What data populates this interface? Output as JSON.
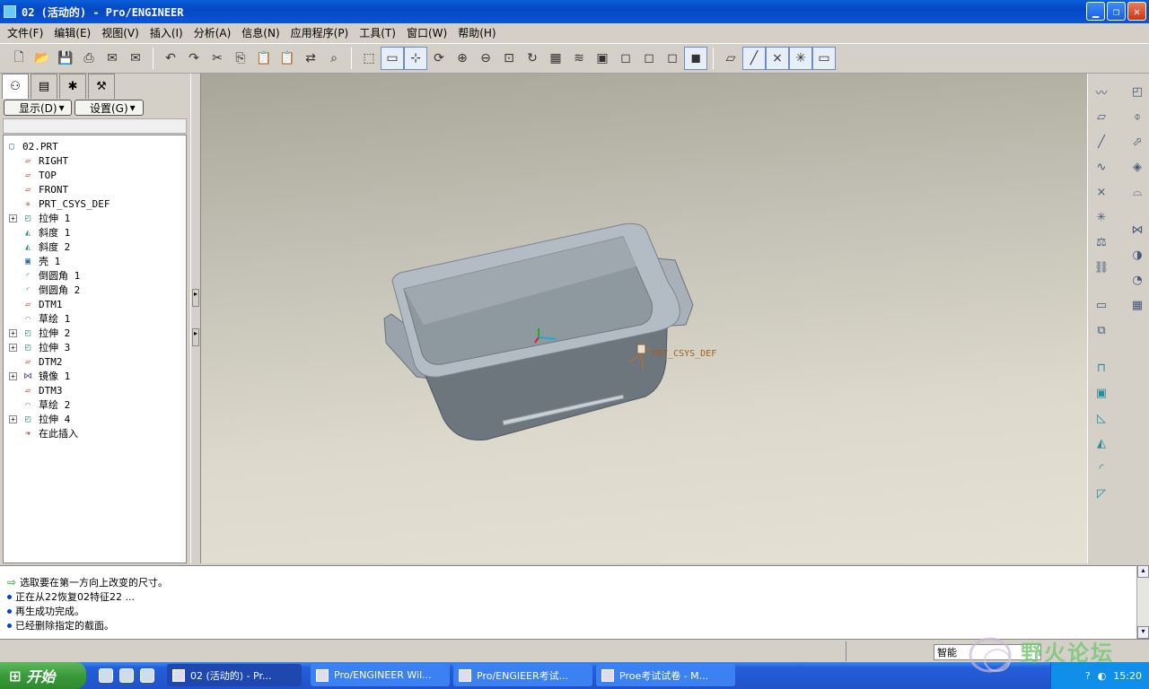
{
  "window": {
    "title": "02 (活动的) - Pro/ENGINEER"
  },
  "menu": [
    "文件(F)",
    "编辑(E)",
    "视图(V)",
    "插入(I)",
    "分析(A)",
    "信息(N)",
    "应用程序(P)",
    "工具(T)",
    "窗口(W)",
    "帮助(H)"
  ],
  "toolbar": {
    "icons": [
      "new-icon",
      "open-icon",
      "save-icon",
      "print-icon",
      "send-icon",
      "send-mail-icon",
      "undo-icon",
      "redo-icon",
      "cut-icon",
      "copy-icon",
      "paste-icon",
      "paste-special-icon",
      "regenerate-icon",
      "find-icon",
      "select-box-icon",
      "redraw-icon",
      "spin-center-icon",
      "orient-mode-icon",
      "zoom-in-icon",
      "zoom-out-icon",
      "refit-icon",
      "reorient-icon",
      "saved-views-icon",
      "layers-icon",
      "view-manager-icon",
      "wireframe-icon",
      "hidden-line-icon",
      "no-hidden-icon",
      "shading-icon",
      "datum-planes-icon",
      "datum-axes-icon",
      "datum-points-icon",
      "csys-icon",
      "annotations-icon"
    ]
  },
  "left": {
    "display_btn": "显示(D)",
    "settings_btn": "设置(G)",
    "tree": [
      {
        "label": "02.PRT",
        "indent": 0,
        "icon": "part-icon",
        "expand": ""
      },
      {
        "label": "RIGHT",
        "indent": 1,
        "icon": "datum-plane-icon",
        "expand": ""
      },
      {
        "label": "TOP",
        "indent": 1,
        "icon": "datum-plane-icon",
        "expand": ""
      },
      {
        "label": "FRONT",
        "indent": 1,
        "icon": "datum-plane-icon",
        "expand": ""
      },
      {
        "label": "PRT_CSYS_DEF",
        "indent": 1,
        "icon": "csys-icon",
        "expand": ""
      },
      {
        "label": "拉伸 1",
        "indent": 1,
        "icon": "extrude-icon",
        "expand": "+"
      },
      {
        "label": "斜度 1",
        "indent": 1,
        "icon": "draft-icon",
        "expand": ""
      },
      {
        "label": "斜度 2",
        "indent": 1,
        "icon": "draft-icon",
        "expand": ""
      },
      {
        "label": "壳 1",
        "indent": 1,
        "icon": "shell-icon",
        "expand": ""
      },
      {
        "label": "倒圆角 1",
        "indent": 1,
        "icon": "round-icon",
        "expand": ""
      },
      {
        "label": "倒圆角 2",
        "indent": 1,
        "icon": "round-icon",
        "expand": ""
      },
      {
        "label": "DTM1",
        "indent": 1,
        "icon": "datum-plane-icon",
        "expand": ""
      },
      {
        "label": "草绘 1",
        "indent": 1,
        "icon": "sketch-icon",
        "expand": ""
      },
      {
        "label": "拉伸 2",
        "indent": 1,
        "icon": "extrude-icon",
        "expand": "+"
      },
      {
        "label": "拉伸 3",
        "indent": 1,
        "icon": "extrude-icon",
        "expand": "+"
      },
      {
        "label": "DTM2",
        "indent": 1,
        "icon": "datum-plane-icon",
        "expand": ""
      },
      {
        "label": "镜像 1",
        "indent": 1,
        "icon": "mirror-icon",
        "expand": "+"
      },
      {
        "label": "DTM3",
        "indent": 1,
        "icon": "datum-plane-icon",
        "expand": ""
      },
      {
        "label": "草绘 2",
        "indent": 1,
        "icon": "sketch-icon",
        "expand": ""
      },
      {
        "label": "拉伸 4",
        "indent": 1,
        "icon": "extrude-icon",
        "expand": "+"
      },
      {
        "label": "在此插入",
        "indent": 1,
        "icon": "insert-here-icon",
        "expand": ""
      }
    ]
  },
  "viewport": {
    "csys_label": "PRT_CSYS_DEF"
  },
  "messages": [
    {
      "text": "选取要在第一方向上改变的尺寸。",
      "kind": "prompt"
    },
    {
      "text": "正在从22恢复02特征22 ...",
      "kind": "info"
    },
    {
      "text": "再生成功完成。",
      "kind": "info"
    },
    {
      "text": "已经删除指定的截面。",
      "kind": "info"
    }
  ],
  "status": {
    "filter": "智能"
  },
  "taskbar": {
    "start": "开始",
    "tasks": [
      "02 (活动的) - Pr...",
      "Pro/ENGINEER Wil...",
      "Pro/ENGIEER考试...",
      "Proe考试试卷 - M..."
    ],
    "clock": "15:20"
  },
  "watermark": {
    "text": "野火论坛"
  }
}
